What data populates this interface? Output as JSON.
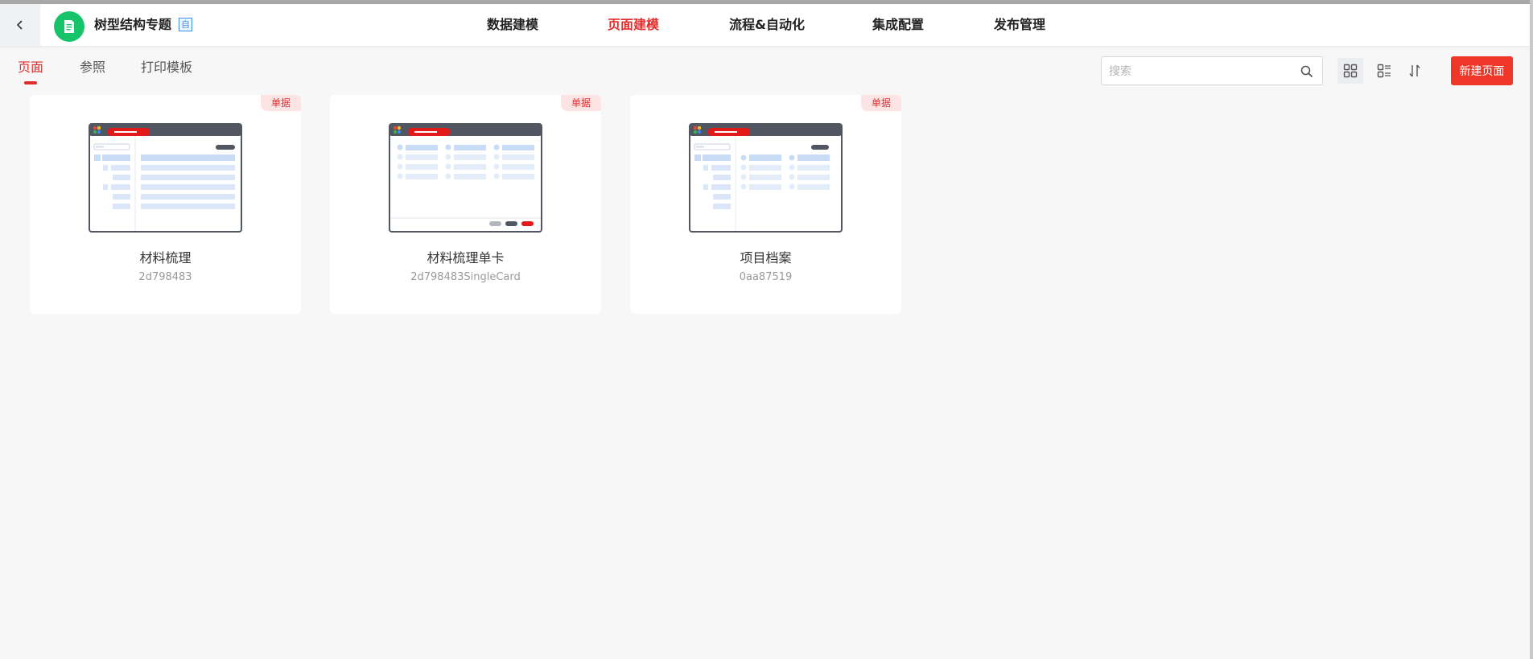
{
  "header": {
    "back_icon": "chevron-left-icon",
    "logo_icon": "document-icon",
    "logo_color": "#18c46a",
    "app_title": "树型结构专题",
    "app_badge": "自",
    "nav": [
      {
        "label": "数据建模",
        "active": false
      },
      {
        "label": "页面建模",
        "active": true
      },
      {
        "label": "流程&自动化",
        "active": false
      },
      {
        "label": "集成配置",
        "active": false
      },
      {
        "label": "发布管理",
        "active": false
      }
    ]
  },
  "toolbar": {
    "tabs": [
      {
        "label": "页面",
        "active": true
      },
      {
        "label": "参照",
        "active": false
      },
      {
        "label": "打印模板",
        "active": false
      }
    ],
    "search": {
      "placeholder": "搜索",
      "value": "",
      "icon": "search-icon"
    },
    "view_icons": [
      "grid-view-icon",
      "list-view-icon",
      "sort-icon"
    ],
    "new_button": "新建页面"
  },
  "cards": [
    {
      "badge": "单据",
      "title": "材料梳理",
      "code": "2d798483",
      "thumb": "tree-list"
    },
    {
      "badge": "单据",
      "title": "材料梳理单卡",
      "code": "2d798483SingleCard",
      "thumb": "single-card"
    },
    {
      "badge": "单据",
      "title": "项目档案",
      "code": "0aa87519",
      "thumb": "tree-grid"
    }
  ],
  "colors": {
    "accent": "#e32d2d",
    "primary_button": "#f03629",
    "badge_bg": "#fde4e4"
  }
}
